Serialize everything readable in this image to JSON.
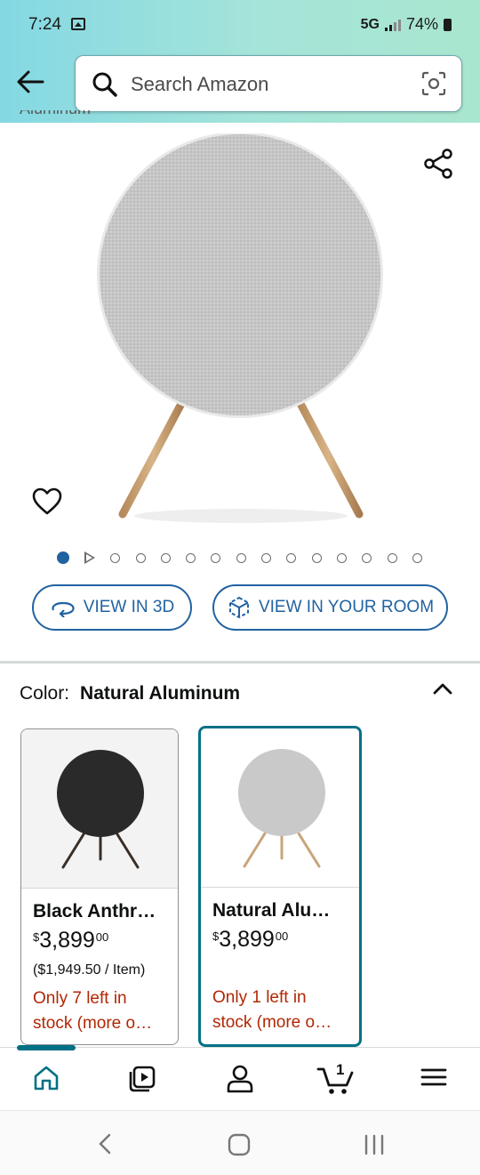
{
  "status_bar": {
    "time": "7:24",
    "network": "5G",
    "battery": "74%"
  },
  "search": {
    "placeholder": "Search Amazon"
  },
  "top": {
    "cut_text": "Aluminum"
  },
  "gallery": {
    "image_count": 15,
    "active_index": 0
  },
  "actions": {
    "view_3d": "VIEW IN 3D",
    "view_room": "VIEW IN YOUR ROOM"
  },
  "color": {
    "label": "Color:",
    "value": "Natural Aluminum"
  },
  "variants": [
    {
      "name": "Black Anthr…",
      "currency": "$",
      "price_whole": "3,899",
      "price_cents": "00",
      "unit_price": "($1,949.50 / Item)",
      "stock_line1": "Only 7 left in",
      "stock_line2": "stock (more o…",
      "color": "#2a2a2a",
      "selected": false
    },
    {
      "name": "Natural Alu…",
      "currency": "$",
      "price_whole": "3,899",
      "price_cents": "00",
      "unit_price": "",
      "stock_line1": "Only 1 left in",
      "stock_line2": "stock (more o…",
      "color": "#c9c9c9",
      "selected": true
    }
  ],
  "bottom_nav": {
    "cart_count": "1",
    "items": [
      "home-icon",
      "video-icon",
      "account-icon",
      "cart-icon",
      "menu-icon"
    ]
  },
  "colors": {
    "accent": "#007185",
    "link": "#2162a1",
    "stock": "#b12704"
  }
}
